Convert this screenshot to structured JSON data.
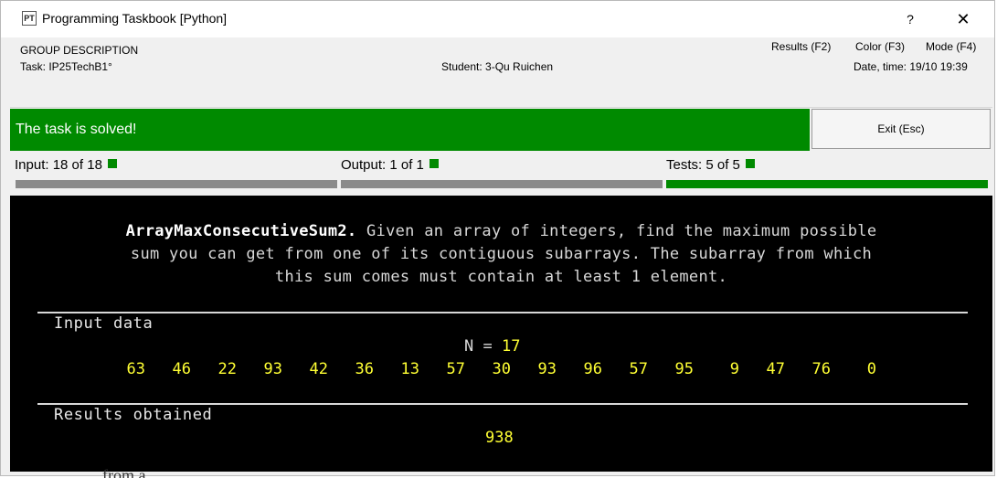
{
  "window": {
    "title": "Programming Taskbook [Python]",
    "app_icon_text": "PT",
    "help_label": "?",
    "close_label": "✕"
  },
  "header": {
    "group_description": "GROUP DESCRIPTION",
    "task": "Task: IP25TechB1°",
    "student": "Student: 3-Qu Ruichen",
    "menu": {
      "results": "Results (F2)",
      "color": "Color (F3)",
      "mode": "Mode (F4)"
    },
    "datetime": "Date, time: 19/10 19:39"
  },
  "status": {
    "message": "The task is solved!",
    "exit_label": "Exit (Esc)",
    "color": "#008a00"
  },
  "progress": {
    "input_label": "Input: 18 of 18",
    "output_label": "Output: 1 of 1",
    "tests_label": "Tests: 5 of 5",
    "input_fraction": 1.0,
    "output_fraction": 1.0,
    "tests_fraction": 1.0
  },
  "task_description": {
    "name": "ArrayMaxConsecutiveSum2.",
    "line1_rest": " Given an array of integers, find the maximum possible",
    "line2": "sum you can get from one of its contiguous subarrays. The subarray from which",
    "line3": "this sum comes must contain at least 1 element."
  },
  "input_data": {
    "label": "Input data",
    "n_prefix": "N = ",
    "n_value": "17",
    "numbers": [
      "63",
      "46",
      "22",
      "93",
      "42",
      "36",
      "13",
      "57",
      "30",
      "93",
      "96",
      "57",
      "95",
      "9",
      "47",
      "76",
      "0"
    ]
  },
  "results": {
    "label": "Results obtained",
    "value": "938"
  },
  "background_text": "from a"
}
